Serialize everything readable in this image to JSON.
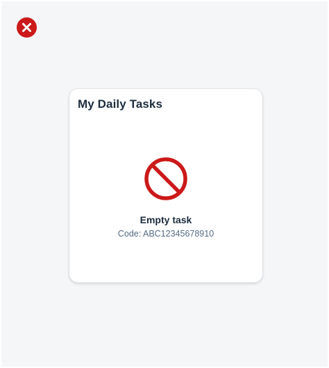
{
  "app": {
    "close_icon": "close-circle-icon",
    "close_color": "#cc1919"
  },
  "card": {
    "title": "My Daily Tasks",
    "status_icon": "prohibited-icon",
    "status_color": "#cc1919",
    "empty_title": "Empty task",
    "code_text": "Code: ABC12345678910"
  }
}
